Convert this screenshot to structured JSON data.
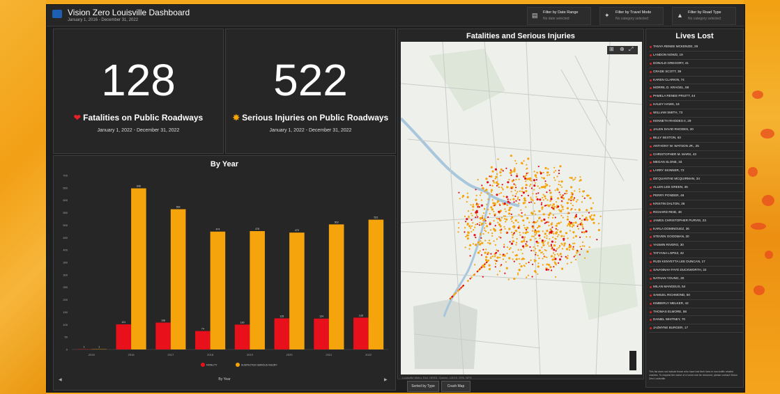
{
  "app": {
    "title": "Vision Zero Louisville Dashboard",
    "subtitle": "January 1, 2016 - December 31, 2022"
  },
  "filters": [
    {
      "label": "Filter by Date Range",
      "status": "No date selected",
      "icon": "calendar-icon"
    },
    {
      "label": "Filter by Travel Mode",
      "status": "No category selected",
      "icon": "pedestrian-icon"
    },
    {
      "label": "Filter by Road Type",
      "status": "No category selected",
      "icon": "road-icon"
    }
  ],
  "kpi_fatalities": {
    "value": "128",
    "label": "Fatalities on Public Roadways",
    "date": "January 1, 2022 - December 31, 2022",
    "color": "#e8202a"
  },
  "kpi_injuries": {
    "value": "522",
    "label": "Serious Injuries on Public Roadways",
    "date": "January 1, 2022 - December 31, 2022",
    "color": "#f5a40c"
  },
  "by_year": {
    "title": "By Year",
    "footer": "By Year"
  },
  "chart_data": {
    "type": "bar",
    "title": "By Year",
    "categories": [
      "2015",
      "2016",
      "2017",
      "2018",
      "2019",
      "2020",
      "2021",
      "2022"
    ],
    "series": [
      {
        "name": "FATALITY",
        "color": "#e8101a",
        "values": [
          1,
          101,
          108,
          74,
          100,
          125,
          124,
          128
        ]
      },
      {
        "name": "SUSPECTED SERIOUS INJURY",
        "color": "#f5a40c",
        "values": [
          1,
          648,
          564,
          474,
          476,
          470,
          503,
          522
        ]
      }
    ],
    "ylim": [
      0,
      700
    ],
    "yticks": [
      "0",
      "50",
      "100",
      "150",
      "200",
      "250",
      "300",
      "350",
      "400",
      "450",
      "500",
      "550",
      "600",
      "650",
      "700"
    ],
    "legend": "bottom",
    "grid": false
  },
  "map_panel": {
    "title": "Fatalities and Serious Injuries",
    "attribution": "Louisville Metro, Esri, HERE, Garmin, USGS, EPA, NPS"
  },
  "lives_lost": {
    "title": "Lives Lost",
    "names": [
      "TANYA RENEE MCKENZIE, 29",
      "LANDON NOWD, 19",
      "DONALD GREGORY, 41",
      "CRADE SCOTT, 39",
      "KAREN CLARKIN, 74",
      "MORRIL D. KRAGEL, 58",
      "PAMELA RENEE PRUITT, 44",
      "HALEY HAWS, 18",
      "WILLIAM SMITH, 73",
      "KENNETH RHODES II, 29",
      "JALEN DAVID RHODES, 20",
      "BILLY SEXTON, 63",
      "ANTHONY W. WATSON JR., 25",
      "CHRISTOPHER M. MARS, 43",
      "MEGAN SLONE, 33",
      "LARRY SKINNER, 72",
      "DE'QUANTAE MCQUIRMAN, 34",
      "ALLEN LEE GREEN, 35",
      "PERRY PONDER, 48",
      "KRISTIN DALTON, 36",
      "RICHARD REID, 48",
      "JAMES CHRISTOPHER PURVIS, 23",
      "KARLA DOMINGUEZ, 36",
      "STEVEN GOODMAN, 20",
      "YASMIN RIVERO, 30",
      "TATYANA LOPEZ, 32",
      "RUDI KENYETTA LEE DUNCAN, 17",
      "SAVANNAH FAYE DUCKWORTH, 22",
      "NATHAN YOUNG, 30",
      "MILAN MANGEUS, 54",
      "SAMUEL RICHMOND, 50",
      "KIMBERLY MELKER, 42",
      "THOMAS ELMORE, 58",
      "DANIEL WHITNEY, 70",
      "JAZMYNE BURGER, 17"
    ],
    "note": "This list does not include those who have lost their lives in non-traffic related crashes. To request the name of a loved one be removed, please contact Vision Zero Louisville."
  },
  "tabs": [
    {
      "label": "Sorted by Type"
    },
    {
      "label": "Crash Map"
    }
  ]
}
